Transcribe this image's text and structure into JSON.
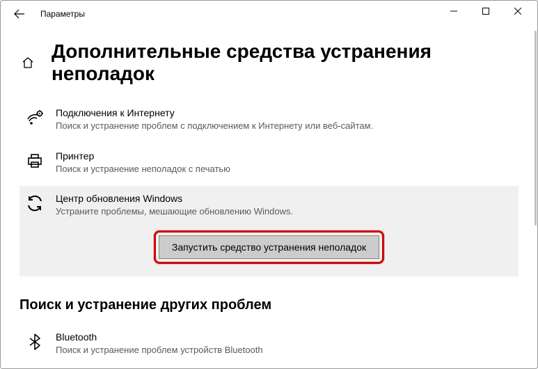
{
  "window": {
    "title": "Параметры"
  },
  "page": {
    "heading": "Дополнительные средства устранения неполадок"
  },
  "items": [
    {
      "title": "Подключения к Интернету",
      "desc": "Поиск и устранение проблем с подключением к Интернету или веб-сайтам."
    },
    {
      "title": "Принтер",
      "desc": "Поиск и устранение неполадок с печатью"
    },
    {
      "title": "Центр обновления Windows",
      "desc": "Устраните проблемы, мешающие обновлению Windows."
    }
  ],
  "run_button": "Запустить средство устранения неполадок",
  "section2": {
    "heading": "Поиск и устранение других проблем"
  },
  "bluetooth": {
    "title": "Bluetooth",
    "desc": "Поиск и устранение проблем устройств Bluetooth"
  }
}
